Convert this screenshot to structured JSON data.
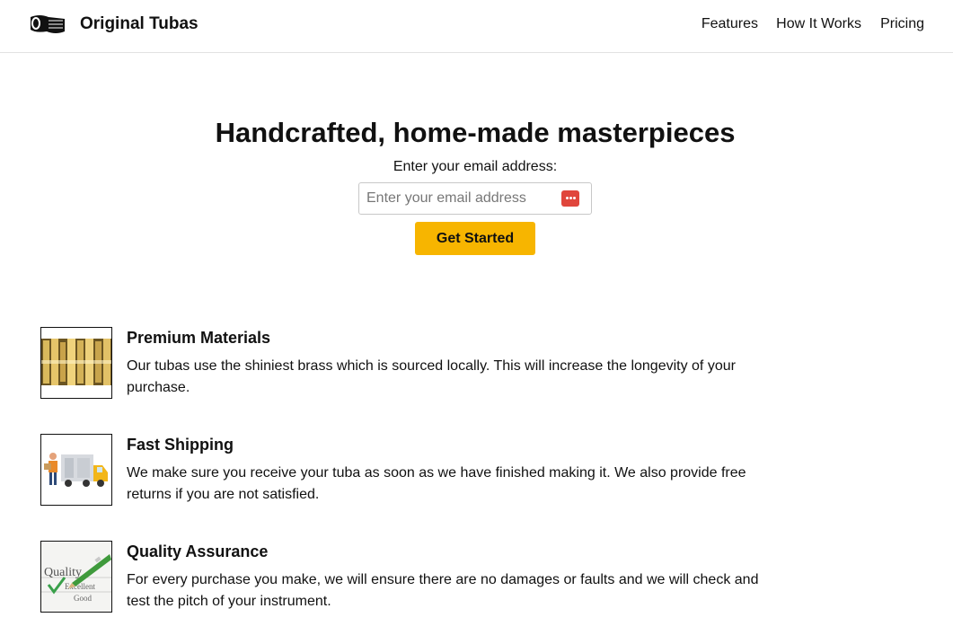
{
  "header": {
    "logo_icon": "tuba-icon",
    "brand": "Original Tubas",
    "nav": [
      {
        "label": "Features"
      },
      {
        "label": "How It Works"
      },
      {
        "label": "Pricing"
      }
    ]
  },
  "hero": {
    "title": "Handcrafted, home-made masterpieces",
    "email_label": "Enter your email address:",
    "email_placeholder": "Enter your email address",
    "email_value": "",
    "password_manager_icon": "password-manager-icon",
    "cta_label": "Get Started"
  },
  "features": [
    {
      "icon": "brass-tubes-image",
      "title": "Premium Materials",
      "description": "Our tubas use the shiniest brass which is sourced locally. This will increase the longevity of your purchase."
    },
    {
      "icon": "delivery-truck-image",
      "title": "Fast Shipping",
      "description": "We make sure you receive your tuba as soon as we have finished making it. We also provide free returns if you are not satisfied."
    },
    {
      "icon": "quality-checkmark-image",
      "title": "Quality Assurance",
      "description": "For every purchase you make, we will ensure there are no damages or faults and we will check and test the pitch of your instrument."
    }
  ],
  "colors": {
    "accent": "#f7b500",
    "text": "#111111",
    "border": "#e2e2e2",
    "password_icon": "#e0463c"
  }
}
